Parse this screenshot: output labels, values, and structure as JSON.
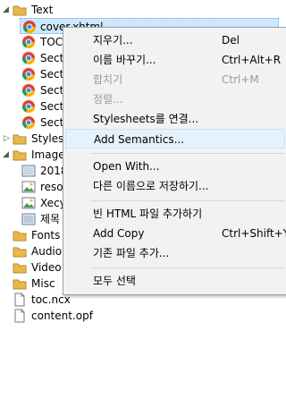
{
  "tree": {
    "text_folder": "Text",
    "files": [
      "cover.xhtml",
      "TOC",
      "Sect",
      "Sect",
      "Sect",
      "Sect",
      "Sect"
    ],
    "styles_folder": "Styles",
    "images_folder": "Image",
    "image_files": [
      "2018",
      "resou",
      "Xecy",
      "제목"
    ],
    "fonts_folder": "Fonts",
    "audio_folder": "Audio",
    "video_folder": "Video",
    "misc_folder": "Misc",
    "toc_file": "toc.ncx",
    "content_file": "content.opf"
  },
  "menu": {
    "rename_items": "지우기...",
    "rename_items_shortcut": "Del",
    "rename": "이름 바꾸기...",
    "rename_shortcut": "Ctrl+Alt+R",
    "merge": "합치기",
    "merge_shortcut": "Ctrl+M",
    "sort": "정렬...",
    "link_stylesheets": "Stylesheets를 연결...",
    "add_semantics": "Add Semantics...",
    "open_with": "Open With...",
    "save_as": "다른 이름으로 저장하기...",
    "add_blank_html": "빈 HTML 파일 추가하기",
    "add_copy": "Add Copy",
    "add_copy_shortcut": "Ctrl+Shift+Y",
    "add_existing": "기존 파일 추가...",
    "select_all": "모두 선택"
  },
  "colors": {
    "folder": "#e8b84a",
    "selection": "#cce8ff",
    "menu_bg": "#f2f2f2",
    "menu_hover": "#e5f1fb"
  }
}
